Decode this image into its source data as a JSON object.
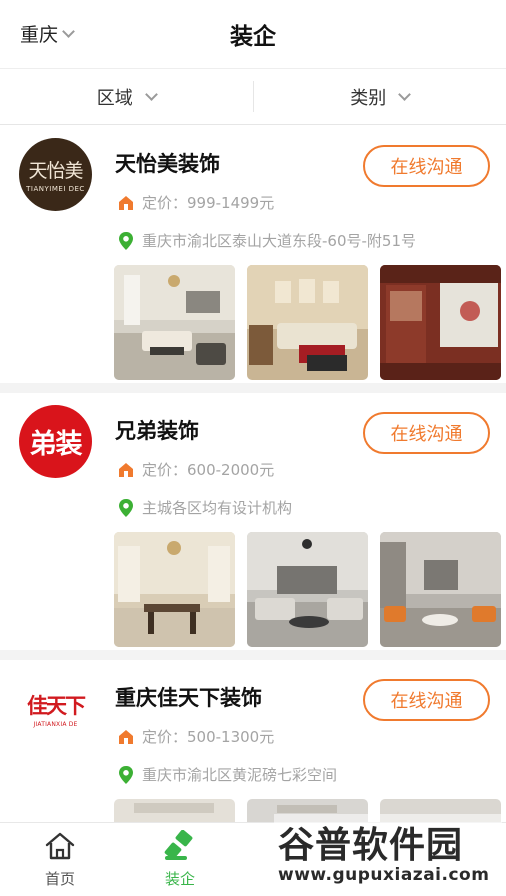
{
  "header": {
    "city": "重庆",
    "title": "装企"
  },
  "filters": [
    {
      "label": "区域"
    },
    {
      "label": "类别"
    }
  ],
  "companies": [
    {
      "name": "天怡美装饰",
      "logo_text": "天怡美",
      "logo_sub": "TIANYIMEI DEC",
      "price": "定价：999-1499元",
      "address": "重庆市渝北区泰山大道东段-60号-附51号",
      "chat_label": "在线沟通"
    },
    {
      "name": "兄弟装饰",
      "logo_text": "弟装",
      "price": "定价：600-2000元",
      "address": "主城各区均有设计机构",
      "chat_label": "在线沟通"
    },
    {
      "name": "重庆佳天下装饰",
      "logo_text": "佳天下",
      "logo_sub": "JIATIANXIA DE",
      "price": "定价：500-1300元",
      "address": "重庆市渝北区黄泥磅七彩空间",
      "chat_label": "在线沟通"
    }
  ],
  "tabbar": [
    {
      "label": "首页"
    },
    {
      "label": "装企"
    }
  ],
  "watermark": {
    "title": "谷普软件园",
    "url": "www.gupuxiazai.com"
  },
  "colors": {
    "accent": "#f07a2e",
    "active_tab": "#39b54a",
    "pin": "#3cb034"
  }
}
